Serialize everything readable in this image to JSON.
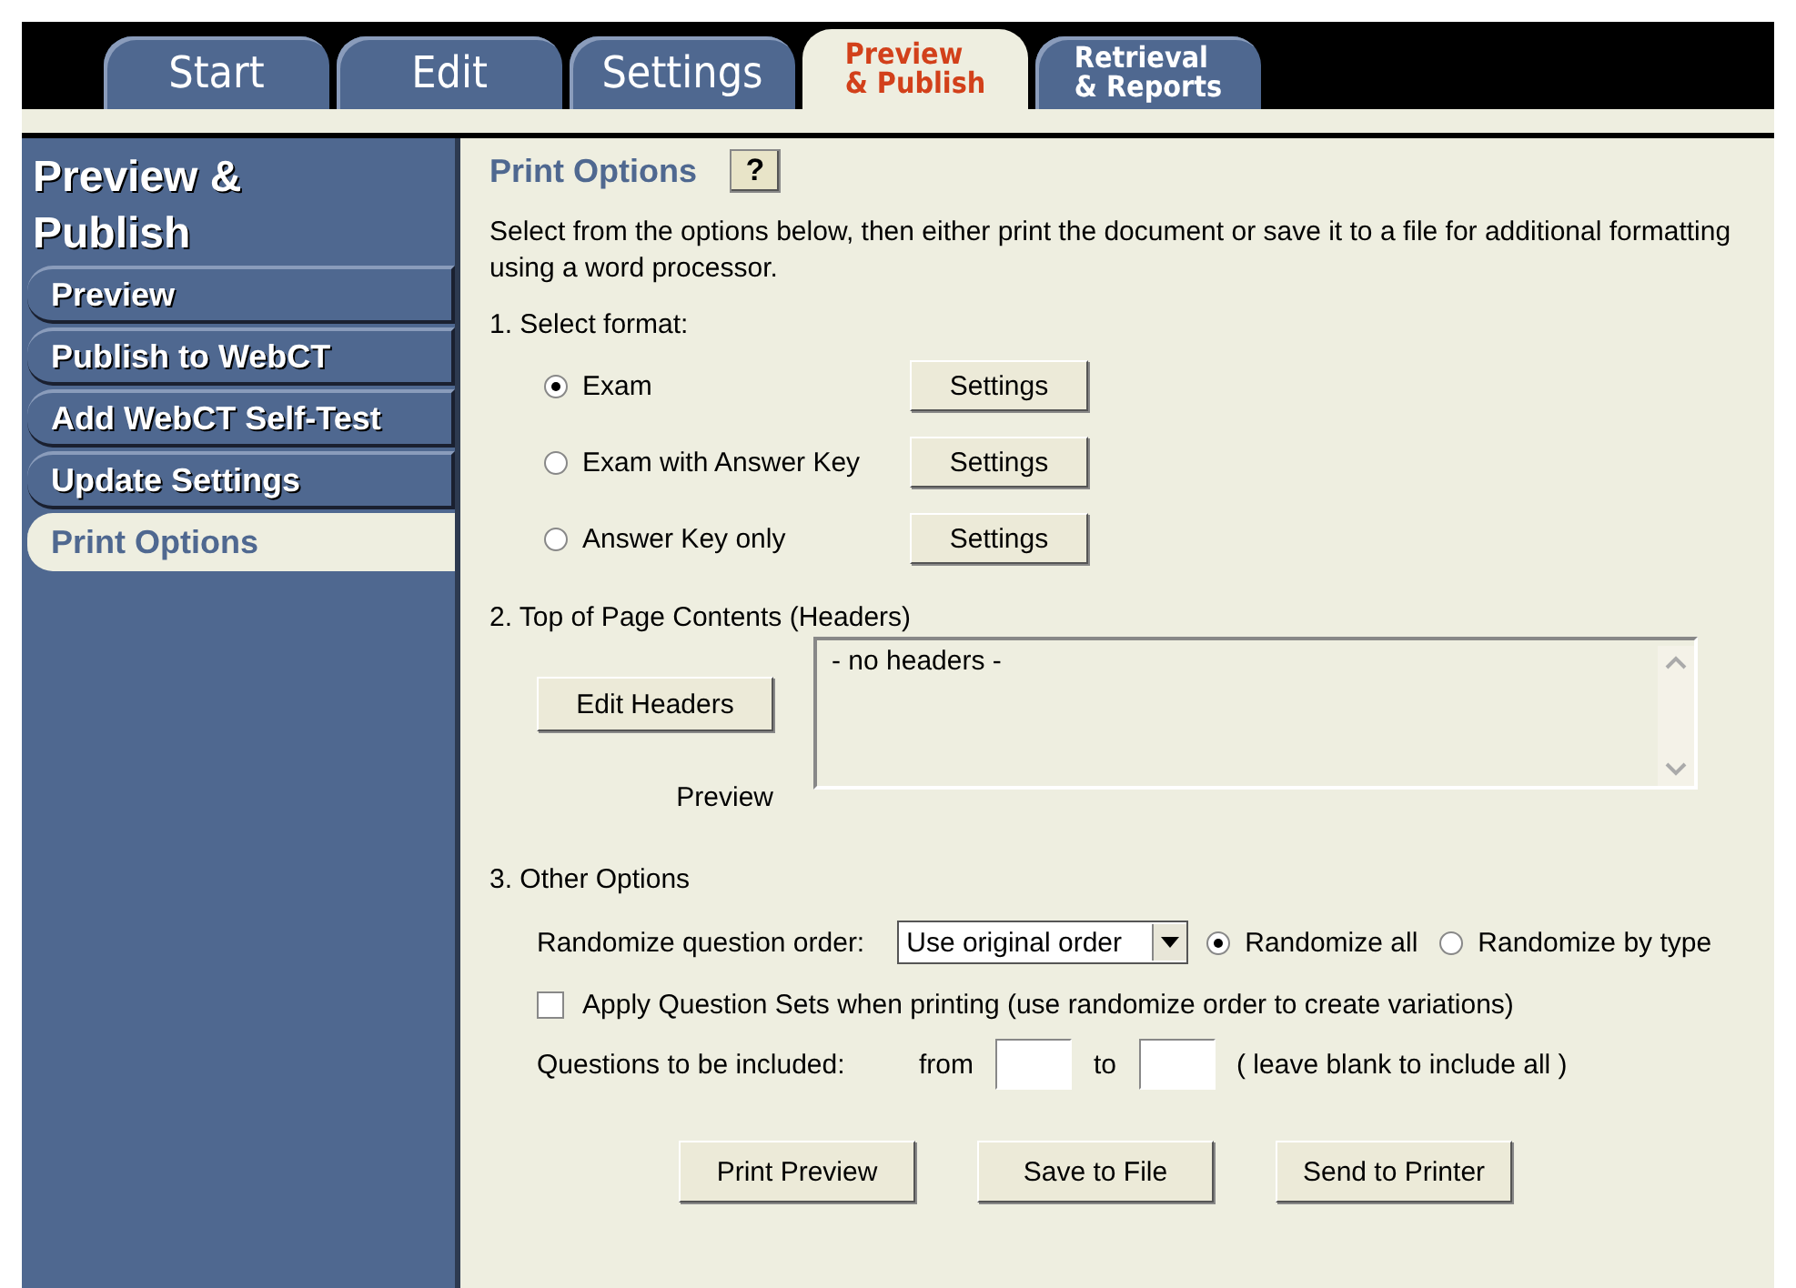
{
  "tabs": [
    {
      "label": "Start",
      "selected": false
    },
    {
      "label": "Edit",
      "selected": false
    },
    {
      "label": "Settings",
      "selected": false
    },
    {
      "label": "Preview\n& Publish",
      "selected": true
    },
    {
      "label": "Retrieval\n& Reports",
      "selected": false
    }
  ],
  "sidebar": {
    "title": "Preview & Publish",
    "items": [
      {
        "label": "Preview",
        "selected": false
      },
      {
        "label": "Publish to WebCT",
        "selected": false
      },
      {
        "label": "Add WebCT Self-Test",
        "selected": false
      },
      {
        "label": "Update Settings",
        "selected": false
      },
      {
        "label": "Print Options",
        "selected": true
      }
    ]
  },
  "page": {
    "title": "Print Options",
    "help": "?",
    "intro": "Select from the options below, then either print the document or save it to a file for additional formatting using a word processor.",
    "format": {
      "heading": "1.  Select format:",
      "options": [
        {
          "label": "Exam",
          "selected": true,
          "button": "Settings"
        },
        {
          "label": "Exam with Answer Key",
          "selected": false,
          "button": "Settings"
        },
        {
          "label": "Answer Key only",
          "selected": false,
          "button": "Settings"
        }
      ]
    },
    "headers": {
      "heading": "2.  Top of Page Contents (Headers)",
      "button": "Edit Headers",
      "preview_label": "Preview",
      "preview_text": "- no headers -"
    },
    "other": {
      "heading": "3.  Other Options",
      "randomize_label": "Randomize question order:",
      "order_select": "Use original order",
      "randomize_options": [
        {
          "label": "Randomize all",
          "selected": true
        },
        {
          "label": "Randomize by type",
          "selected": false
        }
      ],
      "apply_sets": {
        "label": "Apply Question Sets when printing (use randomize order to create variations)",
        "checked": false
      },
      "included_label": "Questions to be included:",
      "from_label": "from",
      "to_label": "to",
      "blank_hint": "( leave blank to include all )"
    },
    "buttons": [
      "Print Preview",
      "Save to File",
      "Send to Printer"
    ]
  }
}
